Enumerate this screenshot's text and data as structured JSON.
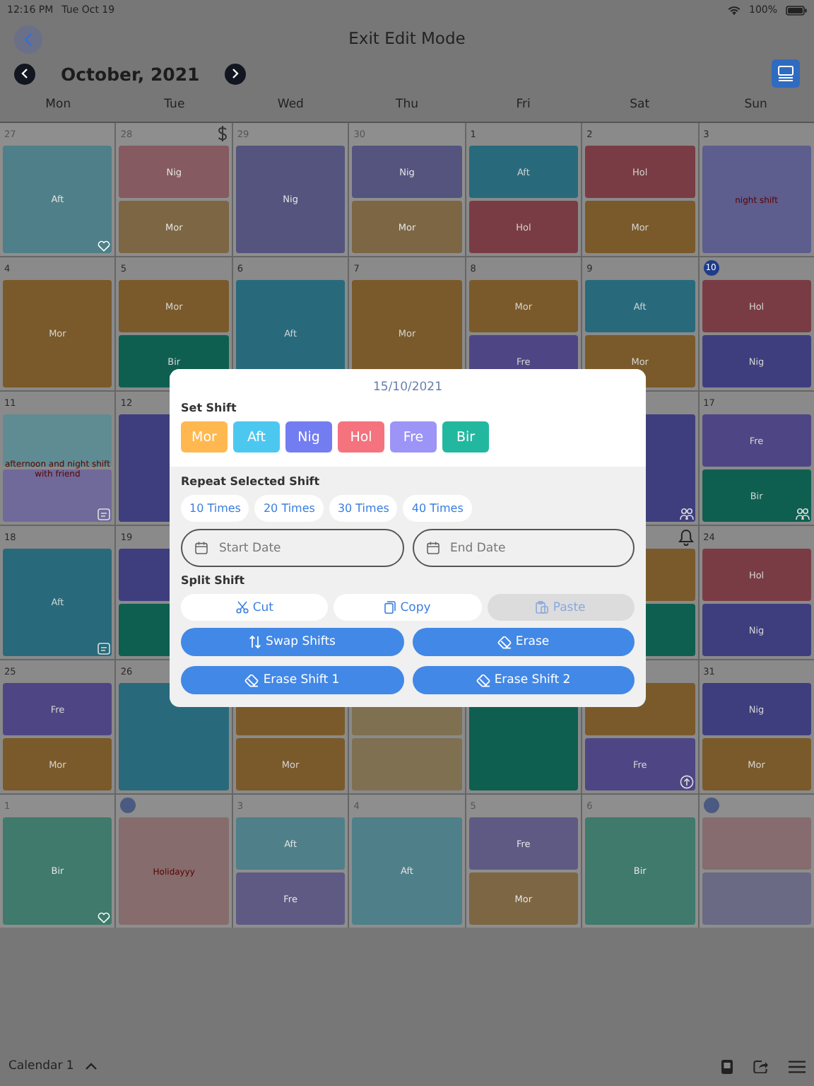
{
  "status_bar": {
    "time": "12:16 PM",
    "date": "Tue Oct 19",
    "battery": "100%"
  },
  "nav": {
    "title": "Exit Edit Mode"
  },
  "month_bar": {
    "month": "October, 2021"
  },
  "weekdays": [
    "Mon",
    "Tue",
    "Wed",
    "Thu",
    "Fri",
    "Sat",
    "Sun"
  ],
  "weeks": [
    {
      "days": [
        {
          "day": "27",
          "other_month": true,
          "badge": {
            "kind": "heart"
          },
          "blocks": [
            {
              "label": "Aft",
              "color": "#4f7f88"
            }
          ]
        },
        {
          "day": "28",
          "other_month": true,
          "badge": {
            "kind": "dollar"
          },
          "blocks": [
            {
              "label": "Nig",
              "color": "#855a60"
            },
            {
              "label": "Mor",
              "color": "#7c6644"
            }
          ]
        },
        {
          "day": "29",
          "other_month": true,
          "blocks": [
            {
              "label": "Nig",
              "color": "#54547e"
            }
          ]
        },
        {
          "day": "30",
          "other_month": true,
          "blocks": [
            {
              "label": "Nig",
              "color": "#54547e"
            },
            {
              "label": "Mor",
              "color": "#7c6644"
            }
          ]
        },
        {
          "day": "1",
          "blocks": [
            {
              "label": "Aft",
              "color": "#286a7c"
            },
            {
              "label": "Hol",
              "color": "#7a3c44"
            }
          ]
        },
        {
          "day": "2",
          "blocks": [
            {
              "label": "Hol",
              "color": "#7a3c44"
            },
            {
              "label": "Mor",
              "color": "#7a5a2a"
            }
          ]
        },
        {
          "day": "3",
          "note": "night shift",
          "blocks": [
            {
              "color": "#5d5d8e"
            }
          ]
        }
      ]
    },
    {
      "days": [
        {
          "day": "4",
          "blocks": [
            {
              "label": "Mor",
              "color": "#7a5a2a"
            }
          ]
        },
        {
          "day": "5",
          "blocks": [
            {
              "label": "Mor",
              "color": "#7a5a2a"
            },
            {
              "label": "Bir",
              "color": "#0f5f50"
            }
          ]
        },
        {
          "day": "6",
          "blocks": [
            {
              "label": "Aft",
              "color": "#286a7c"
            }
          ]
        },
        {
          "day": "7",
          "blocks": [
            {
              "label": "Mor",
              "color": "#7a5a2a"
            }
          ]
        },
        {
          "day": "8",
          "blocks": [
            {
              "label": "Mor",
              "color": "#7a5a2a"
            },
            {
              "label": "Fre",
              "color": "#4e4684"
            }
          ]
        },
        {
          "day": "9",
          "blocks": [
            {
              "label": "Aft",
              "color": "#286a7c"
            },
            {
              "label": "Mor",
              "color": "#7a5a2a"
            }
          ]
        },
        {
          "day": "10",
          "circle": true,
          "blocks": [
            {
              "label": "Hol",
              "color": "#7a3c44"
            },
            {
              "label": "Nig",
              "color": "#3e3e7e"
            }
          ]
        }
      ]
    },
    {
      "days": [
        {
          "day": "11",
          "badge": {
            "kind": "note"
          },
          "note": "afternoon and night shift with friend",
          "blocks": [
            {
              "color": "#5f8c92"
            },
            {
              "color": "#6f6a9a"
            }
          ]
        },
        {
          "day": "12",
          "blocks": [
            {
              "color": "#3e3e7e"
            }
          ]
        }
      ],
      "days_right": [
        {
          "badge": {
            "kind": "people"
          },
          "blocks": [
            {
              "color": "#3e3e7e"
            }
          ]
        },
        {
          "day": "17",
          "badge": {
            "kind": "people"
          },
          "blocks": [
            {
              "label": "Fre",
              "color": "#4e4684"
            },
            {
              "label": "Bir",
              "color": "#0f5f50"
            }
          ]
        }
      ]
    },
    {
      "days": [
        {
          "day": "18",
          "badge": {
            "kind": "note"
          },
          "blocks": [
            {
              "label": "Aft",
              "color": "#286a7c"
            }
          ]
        },
        {
          "day": "19",
          "blocks": [
            {
              "color": "#3e3e7e"
            },
            {
              "color": "#0f5f50"
            }
          ]
        }
      ],
      "days_right": [
        {
          "badge": {
            "kind": "bell"
          },
          "blocks": [
            {
              "color": "#7a5a2a"
            },
            {
              "color": "#0f5f50"
            }
          ]
        },
        {
          "day": "24",
          "blocks": [
            {
              "label": "Hol",
              "color": "#7a3c44"
            },
            {
              "label": "Nig",
              "color": "#3e3e7e"
            }
          ]
        }
      ]
    },
    {
      "days": [
        {
          "day": "25",
          "blocks": [
            {
              "label": "Fre",
              "color": "#4e4684"
            },
            {
              "label": "Mor",
              "color": "#7a5a2a"
            }
          ]
        },
        {
          "day": "26",
          "blocks": [
            {
              "color": "#286a7c"
            }
          ]
        },
        {
          "blocks": [
            {
              "color": "#7a5a2a"
            },
            {
              "label": "Mor",
              "color": "#7a5a2a"
            }
          ]
        },
        {
          "blocks": [
            {
              "color": "#7f7052"
            },
            {
              "color": "#7f7052"
            }
          ]
        },
        {
          "blocks": [
            {
              "color": "#0f5f50"
            }
          ]
        },
        {
          "badge": {
            "kind": "circle"
          },
          "blocks": [
            {
              "color": "#7a5a2a"
            },
            {
              "label": "Fre",
              "color": "#4e4684"
            }
          ]
        },
        {
          "day": "31",
          "blocks": [
            {
              "label": "Nig",
              "color": "#3e3e7e"
            },
            {
              "label": "Mor",
              "color": "#7a5a2a"
            }
          ]
        }
      ]
    },
    {
      "days": [
        {
          "day": "1",
          "other_month": true,
          "badge": {
            "kind": "heart"
          },
          "blocks": [
            {
              "label": "Bir",
              "color": "#3f7a6c"
            }
          ]
        },
        {
          "circle": true,
          "other_month": true,
          "note": "Holidayyy",
          "blocks": [
            {
              "color": "#866c6c"
            }
          ]
        },
        {
          "day": "3",
          "other_month": true,
          "blocks": [
            {
              "label": "Aft",
              "color": "#4f7f88"
            },
            {
              "label": "Fre",
              "color": "#5e5a84"
            }
          ]
        },
        {
          "day": "4",
          "other_month": true,
          "blocks": [
            {
              "label": "Aft",
              "color": "#4f7f88"
            }
          ]
        },
        {
          "day": "5",
          "other_month": true,
          "blocks": [
            {
              "label": "Fre",
              "color": "#5e5a84"
            },
            {
              "label": "Mor",
              "color": "#7c6644"
            }
          ]
        },
        {
          "day": "6",
          "other_month": true,
          "blocks": [
            {
              "label": "Bir",
              "color": "#3f7a6c"
            }
          ]
        },
        {
          "circle": true,
          "other_month": true,
          "blocks": [
            {
              "color": "#866c6e"
            },
            {
              "color": "#6a6a84"
            }
          ]
        }
      ]
    }
  ],
  "dialog": {
    "date": "15/10/2021",
    "set_shift_title": "Set Shift",
    "shifts": [
      {
        "label": "Mor",
        "color": "#ffb84f"
      },
      {
        "label": "Aft",
        "color": "#4cc8f0"
      },
      {
        "label": "Nig",
        "color": "#737df2"
      },
      {
        "label": "Hol",
        "color": "#f4737e"
      },
      {
        "label": "Fre",
        "color": "#9c94f6"
      },
      {
        "label": "Bir",
        "color": "#22b8a0"
      }
    ],
    "repeat_title": "Repeat Selected Shift",
    "repeat_options": [
      "10 Times",
      "20 Times",
      "30 Times",
      "40 Times"
    ],
    "start_date": {
      "placeholder": "Start Date"
    },
    "end_date": {
      "placeholder": "End Date"
    },
    "split_title": "Split Shift",
    "clipboard": [
      {
        "kind": "cut",
        "label": "Cut",
        "disabled": false
      },
      {
        "kind": "copy",
        "label": "Copy",
        "disabled": false
      },
      {
        "kind": "paste",
        "label": "Paste",
        "disabled": true
      }
    ],
    "actions": [
      {
        "kind": "swap",
        "label": "Swap Shifts"
      },
      {
        "kind": "erase",
        "label": "Erase"
      },
      {
        "kind": "erase",
        "label": "Erase Shift 1"
      },
      {
        "kind": "erase",
        "label": "Erase Shift 2"
      }
    ]
  },
  "bottom_bar": {
    "calendar": "Calendar 1"
  }
}
